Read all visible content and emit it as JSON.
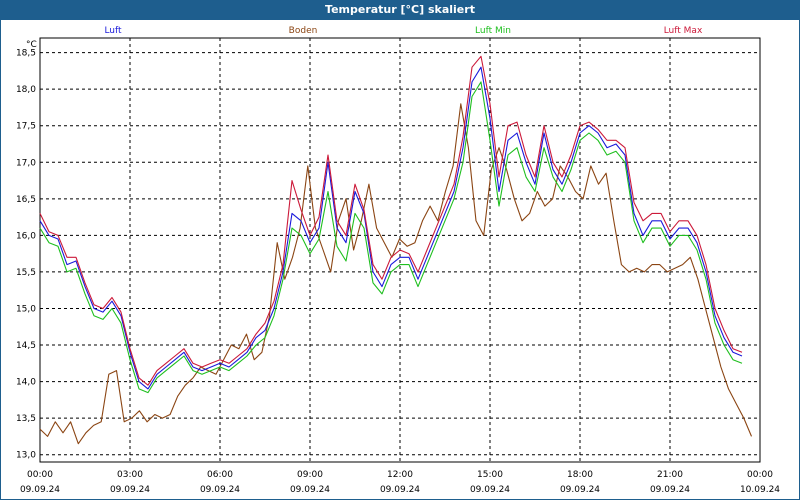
{
  "window": {
    "title": "Temperatur [°C] skaliert"
  },
  "colors": {
    "titlebar": "#1e5e8e",
    "luft": "#1a1adb",
    "boden": "#8b4513",
    "luft_min": "#1fbf1f",
    "luft_max": "#cc1a3a"
  },
  "chart_data": {
    "type": "line",
    "title": "Temperatur [°C] skaliert",
    "ylabel": "°C",
    "xlabel": "",
    "ylim": [
      12.9,
      18.7
    ],
    "xlim": [
      0,
      24
    ],
    "grid": true,
    "legend_placement": "top",
    "y_ticks": [
      "13,0",
      "13,5",
      "14,0",
      "14,5",
      "15,0",
      "15,5",
      "16,0",
      "16,5",
      "17,0",
      "17,5",
      "18,0",
      "18,5"
    ],
    "x_ticks": [
      {
        "time": "00:00",
        "date": "09.09.24"
      },
      {
        "time": "03:00",
        "date": "09.09.24"
      },
      {
        "time": "06:00",
        "date": "09.09.24"
      },
      {
        "time": "09:00",
        "date": "09.09.24"
      },
      {
        "time": "12:00",
        "date": "09.09.24"
      },
      {
        "time": "15:00",
        "date": "09.09.24"
      },
      {
        "time": "18:00",
        "date": "09.09.24"
      },
      {
        "time": "21:00",
        "date": "09.09.24"
      },
      {
        "time": "00:00",
        "date": "10.09.24"
      }
    ],
    "x_hours": [
      0,
      0.25,
      0.5,
      0.75,
      1,
      1.25,
      1.5,
      1.75,
      2,
      2.25,
      2.5,
      2.75,
      3,
      3.25,
      3.5,
      3.75,
      4,
      4.25,
      4.5,
      4.75,
      5,
      5.25,
      5.5,
      5.75,
      6,
      6.25,
      6.5,
      6.75,
      7,
      7.25,
      7.5,
      7.75,
      8,
      8.25,
      8.5,
      8.75,
      9,
      9.25,
      9.5,
      9.75,
      10,
      10.25,
      10.5,
      10.75,
      11,
      11.25,
      11.5,
      11.75,
      12,
      12.25,
      12.5,
      12.75,
      13,
      13.25,
      13.5,
      13.75,
      14,
      14.25,
      14.5,
      14.75,
      15,
      15.25,
      15.5,
      15.75,
      16,
      16.25,
      16.5,
      16.75,
      17,
      17.25,
      17.5,
      17.75,
      18,
      18.25,
      18.5,
      18.75,
      19,
      19.25,
      19.5,
      19.75,
      20,
      20.25,
      20.5,
      20.75,
      21,
      21.25,
      21.5,
      21.75,
      22,
      22.25,
      22.5,
      22.75,
      23,
      23.25,
      23.5,
      23.75,
      24
    ],
    "series": [
      {
        "name": "Luft",
        "values": [
          16.2,
          16.0,
          15.95,
          15.6,
          15.65,
          15.3,
          15.0,
          14.95,
          15.1,
          14.9,
          14.4,
          14.0,
          13.9,
          14.1,
          14.2,
          14.3,
          14.4,
          14.2,
          14.15,
          14.2,
          14.25,
          14.2,
          14.3,
          14.4,
          14.6,
          14.7,
          15.0,
          15.5,
          16.3,
          16.2,
          15.9,
          16.1,
          17.0,
          16.1,
          15.9,
          16.6,
          16.3,
          15.5,
          15.3,
          15.6,
          15.7,
          15.7,
          15.4,
          15.7,
          16.0,
          16.3,
          16.6,
          17.2,
          18.1,
          18.3,
          17.6,
          16.6,
          17.3,
          17.4,
          17.0,
          16.7,
          17.4,
          16.9,
          16.7,
          17.0,
          17.4,
          17.5,
          17.4,
          17.2,
          17.25,
          17.1,
          16.3,
          16.0,
          16.2,
          16.2,
          15.95,
          16.1,
          16.1,
          15.9,
          15.5,
          14.9,
          14.6,
          14.4,
          14.35
        ],
        "x_step": 0.3
      },
      {
        "name": "Boden",
        "values": [
          13.35,
          13.25,
          13.45,
          13.3,
          13.45,
          13.15,
          13.3,
          13.4,
          13.45,
          14.1,
          14.15,
          13.45,
          13.5,
          13.6,
          13.45,
          13.55,
          13.5,
          13.55,
          13.8,
          13.95,
          14.05,
          14.2,
          14.15,
          14.1,
          14.3,
          14.5,
          14.45,
          14.65,
          14.3,
          14.4,
          14.9,
          15.9,
          15.4,
          15.7,
          16.1,
          16.95,
          16.1,
          15.8,
          15.5,
          16.2,
          16.5,
          15.8,
          16.2,
          16.7,
          16.1,
          15.9,
          15.7,
          15.95,
          15.85,
          15.9,
          16.2,
          16.4,
          16.2,
          16.6,
          16.95,
          17.8,
          17.2,
          16.2,
          16.0,
          16.9,
          17.2,
          16.9,
          16.5,
          16.2,
          16.3,
          16.6,
          16.4,
          16.5,
          16.95,
          16.8,
          16.6,
          16.5,
          16.95,
          16.7,
          16.85,
          16.2,
          15.6,
          15.5,
          15.55,
          15.5,
          15.6,
          15.6,
          15.5,
          15.55,
          15.6,
          15.7,
          15.4,
          15.0,
          14.6,
          14.2,
          13.9,
          13.7,
          13.5,
          13.25
        ],
        "x_step": 0.255
      },
      {
        "name": "Luft Min",
        "values": [
          16.1,
          15.9,
          15.85,
          15.5,
          15.55,
          15.2,
          14.9,
          14.85,
          15.0,
          14.8,
          14.3,
          13.9,
          13.85,
          14.05,
          14.15,
          14.25,
          14.35,
          14.15,
          14.1,
          14.15,
          14.2,
          14.15,
          14.25,
          14.35,
          14.5,
          14.6,
          14.9,
          15.4,
          16.1,
          16.0,
          15.75,
          15.95,
          16.6,
          15.85,
          15.65,
          16.3,
          16.1,
          15.35,
          15.2,
          15.5,
          15.6,
          15.6,
          15.3,
          15.6,
          15.9,
          16.2,
          16.5,
          17.0,
          17.9,
          18.1,
          17.3,
          16.4,
          17.1,
          17.2,
          16.8,
          16.6,
          17.2,
          16.8,
          16.6,
          16.9,
          17.3,
          17.4,
          17.3,
          17.1,
          17.15,
          17.0,
          16.2,
          15.9,
          16.1,
          16.1,
          15.85,
          16.0,
          16.0,
          15.8,
          15.4,
          14.8,
          14.5,
          14.3,
          14.25
        ],
        "x_step": 0.3
      },
      {
        "name": "Luft Max",
        "values": [
          16.3,
          16.05,
          16.0,
          15.7,
          15.7,
          15.35,
          15.05,
          15.0,
          15.15,
          14.95,
          14.45,
          14.05,
          13.95,
          14.15,
          14.25,
          14.35,
          14.45,
          14.25,
          14.2,
          14.25,
          14.3,
          14.25,
          14.35,
          14.45,
          14.65,
          14.8,
          15.1,
          15.6,
          16.75,
          16.35,
          16.0,
          16.25,
          17.1,
          16.2,
          16.0,
          16.7,
          16.35,
          15.6,
          15.4,
          15.7,
          15.8,
          15.75,
          15.5,
          15.8,
          16.1,
          16.4,
          16.7,
          17.35,
          18.3,
          18.45,
          17.8,
          16.8,
          17.5,
          17.55,
          17.1,
          16.8,
          17.5,
          17.0,
          16.8,
          17.1,
          17.5,
          17.55,
          17.45,
          17.3,
          17.3,
          17.2,
          16.45,
          16.2,
          16.3,
          16.3,
          16.05,
          16.2,
          16.2,
          16.0,
          15.6,
          15.0,
          14.7,
          14.45,
          14.4
        ],
        "x_step": 0.3
      }
    ]
  }
}
